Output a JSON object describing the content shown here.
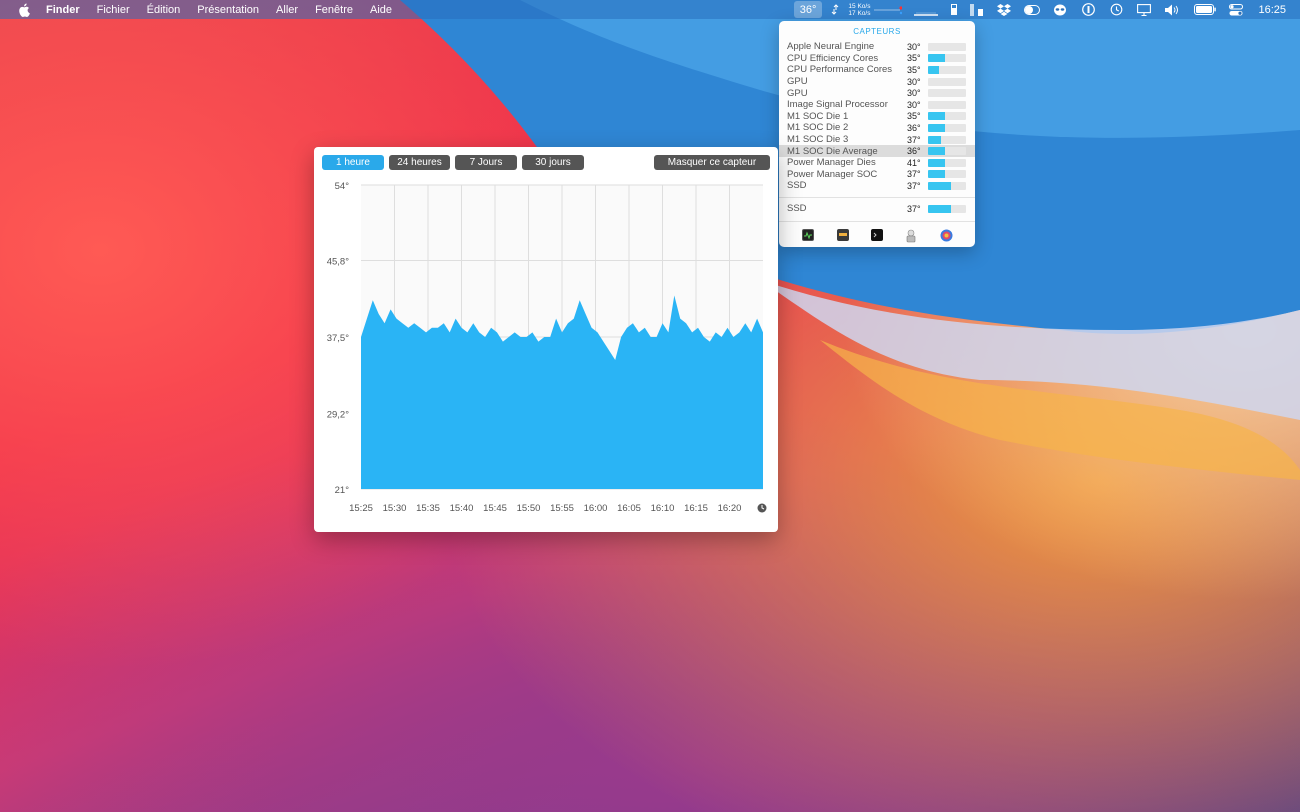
{
  "menubar": {
    "app": "Finder",
    "items": [
      "Fichier",
      "Édition",
      "Présentation",
      "Aller",
      "Fenêtre",
      "Aide"
    ],
    "temperature": "36°",
    "net_up": "15 Ko/s",
    "net_down": "17 Ko/s",
    "clock": "16:25",
    "status_icons": [
      "arrows-icon",
      "network-graph-icon",
      "memory-icon",
      "disk-icon",
      "dropbox-icon",
      "toggle-icon",
      "alien-icon",
      "1password-icon",
      "time-machine-icon",
      "display-icon",
      "volume-icon",
      "battery-icon",
      "control-center-icon"
    ]
  },
  "sensors": {
    "title": "CAPTEURS",
    "rows": [
      {
        "name": "Apple Neural Engine",
        "value": "30°",
        "level": 0.0
      },
      {
        "name": "CPU Efficiency Cores",
        "value": "35°",
        "level": 0.45
      },
      {
        "name": "CPU Performance Cores",
        "value": "35°",
        "level": 0.28
      },
      {
        "name": "GPU",
        "value": "30°",
        "level": 0.0
      },
      {
        "name": "GPU",
        "value": "30°",
        "level": 0.0
      },
      {
        "name": "Image Signal Processor",
        "value": "30°",
        "level": 0.0
      },
      {
        "name": "M1 SOC Die 1",
        "value": "35°",
        "level": 0.45
      },
      {
        "name": "M1 SOC Die 2",
        "value": "36°",
        "level": 0.45
      },
      {
        "name": "M1 SOC Die 3",
        "value": "37°",
        "level": 0.35
      },
      {
        "name": "M1 SOC Die Average",
        "value": "36°",
        "level": 0.45,
        "highlight": true
      },
      {
        "name": "Power Manager Dies",
        "value": "41°",
        "level": 0.45
      },
      {
        "name": "Power Manager SOC",
        "value": "37°",
        "level": 0.45
      },
      {
        "name": "SSD",
        "value": "37°",
        "level": 0.6
      }
    ],
    "ssd": {
      "name": "SSD",
      "value": "37°",
      "level": 0.6
    },
    "tools": [
      "activity-monitor-icon",
      "console-icon",
      "terminal-icon",
      "automator-icon",
      "system-info-icon"
    ]
  },
  "chart_window": {
    "tabs": [
      {
        "label": "1 heure",
        "active": true
      },
      {
        "label": "24 heures",
        "active": false
      },
      {
        "label": "7 Jours",
        "active": false
      },
      {
        "label": "30 jours",
        "active": false
      }
    ],
    "hide_button": "Masquer ce capteur"
  },
  "chart_data": {
    "type": "area",
    "title": "",
    "xlabel": "",
    "ylabel": "",
    "ylim": [
      21,
      54
    ],
    "y_tick_labels": [
      "54°",
      "45,8°",
      "37,5°",
      "29,2°",
      "21°"
    ],
    "y_ticks": [
      54,
      45.8,
      37.5,
      29.2,
      21
    ],
    "x_tick_labels": [
      "15:25",
      "15:30",
      "15:35",
      "15:40",
      "15:45",
      "15:50",
      "15:55",
      "16:00",
      "16:05",
      "16:10",
      "16:15",
      "16:20"
    ],
    "grid": true,
    "color": "#2ab4f5",
    "series": [
      {
        "values": [
          37.5,
          39.5,
          41.5,
          40.0,
          39.0,
          40.5,
          39.5,
          39.0,
          38.5,
          39.0,
          38.5,
          38.0,
          38.5,
          38.5,
          39.0,
          38.0,
          39.5,
          38.5,
          38.0,
          39.0,
          38.0,
          37.5,
          38.5,
          38.0,
          37.0,
          37.5,
          38.0,
          37.5,
          37.5,
          38.0,
          37.0,
          37.5,
          37.5,
          39.5,
          38.0,
          39.0,
          39.5,
          41.5,
          40.0,
          38.5,
          38.0,
          37.0,
          36.0,
          35.0,
          37.5,
          38.5,
          39.0,
          38.0,
          38.5,
          37.5,
          37.5,
          39.0,
          38.0,
          42.0,
          39.5,
          39.0,
          38.0,
          38.5,
          37.5,
          37.0,
          38.0,
          37.5,
          38.5,
          37.5,
          38.0,
          39.0,
          38.0,
          39.5,
          38.0
        ]
      }
    ]
  }
}
